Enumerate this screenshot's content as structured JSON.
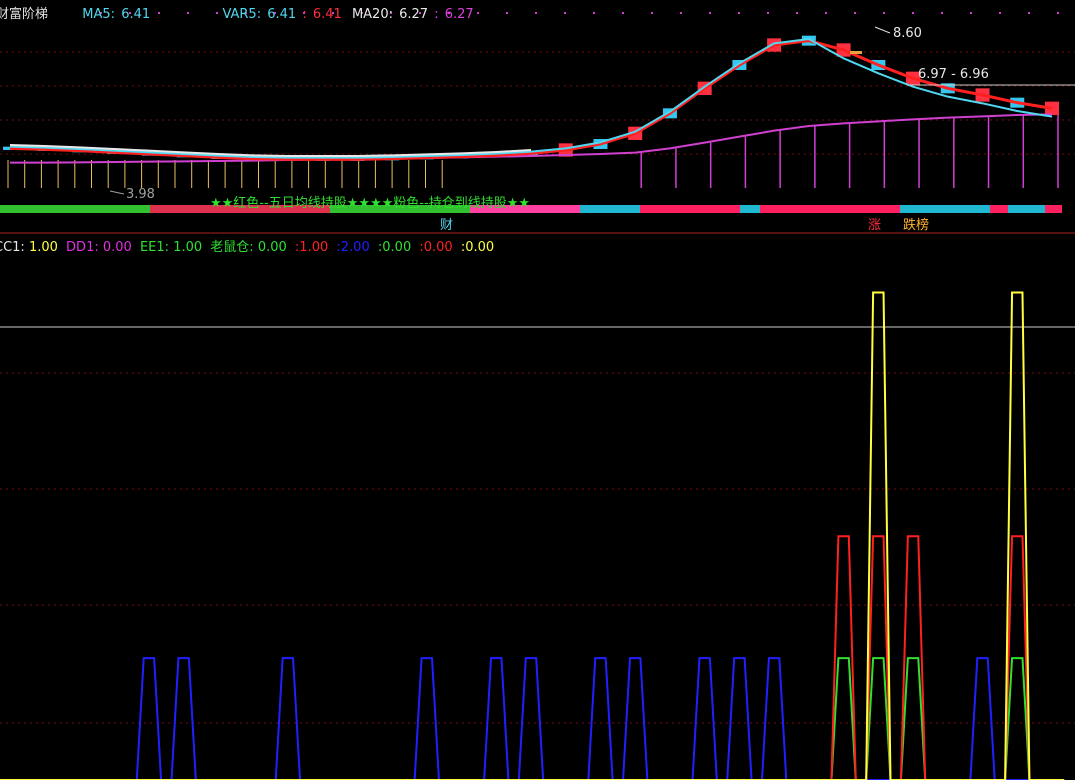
{
  "colors": {
    "background": "#000000",
    "up": "#ff3040",
    "down": "#34c8f0",
    "ma5": "#ff2020",
    "ma20": "#d040d0",
    "cyan_line": "#50d8f0",
    "white_line": "#e8e8e8",
    "gridline": "#7a0a0a",
    "yellow": "#ffff40",
    "green": "#30e030",
    "blue": "#2020ff",
    "red": "#ff2020",
    "magenta": "#e030e0"
  },
  "main_header": {
    "title": "财富阶梯",
    "ma5_label": "MA5:",
    "ma5_value": "6.41",
    "var5_label": "VAR5:",
    "var5_value1": "6.41",
    "var5_sep": ":",
    "var5_value2": "6.41",
    "ma20_label": "MA20:",
    "ma20_value1": "6.27",
    "ma20_sep": ":",
    "ma20_value2": "6.27"
  },
  "main_annotations": {
    "high_label": "8.60",
    "low_label": "3.98",
    "range_label": "6.97 - 6.96",
    "banner_text": "★★红色--五日均线持股★★★★粉色--持仓到线持股★★",
    "cai_label": "财",
    "zhang_label": "涨",
    "dieban_label": "跌榜"
  },
  "indicator_header": {
    "cc1_label": "CC1:",
    "cc1_value": "1.00",
    "dd1_label": "DD1:",
    "dd1_value": "0.00",
    "ee1_label": "EE1:",
    "ee1_value": "1.00",
    "lsc_label": "老鼠仓:",
    "lsc_value": "0.00",
    "v2": "1.00",
    "v3": "2.00",
    "v4": "0.00",
    "v5": "0.00",
    "v6": "0.00"
  },
  "chart_data": [
    {
      "type": "line",
      "title": "财富阶梯",
      "series": [
        {
          "name": "MA5",
          "values": [
            5.25,
            5.22,
            5.18,
            5.13,
            5.08,
            5.03,
            4.98,
            4.94,
            4.92,
            4.92,
            4.92,
            4.94,
            4.97,
            5.0,
            5.04,
            5.1,
            5.2,
            5.38,
            5.7,
            6.3,
            7.05,
            7.75,
            8.35,
            8.48,
            8.2,
            7.75,
            7.35,
            7.05,
            6.85,
            6.62,
            6.45
          ]
        },
        {
          "name": "MA20",
          "values": [
            4.82,
            4.82,
            4.83,
            4.84,
            4.85,
            4.86,
            4.87,
            4.88,
            4.9,
            4.92,
            4.93,
            4.95,
            4.96,
            4.98,
            5.0,
            5.02,
            5.05,
            5.08,
            5.12,
            5.25,
            5.42,
            5.6,
            5.78,
            5.92,
            6.0,
            6.06,
            6.12,
            6.17,
            6.21,
            6.25,
            6.27
          ]
        }
      ],
      "high": 8.6,
      "low": 3.98,
      "ylim": [
        3.7,
        9.1
      ]
    },
    {
      "type": "line",
      "title": "",
      "series": [
        {
          "name": "CC1",
          "values": [
            0,
            0,
            0,
            0,
            0,
            0,
            0,
            0,
            0,
            0,
            0,
            0,
            0,
            0,
            0,
            0,
            0,
            0,
            0,
            0,
            0,
            0,
            0,
            0,
            0,
            4.0,
            0,
            0,
            0,
            4.0,
            0
          ]
        },
        {
          "name": "DD1",
          "values": [
            0,
            0,
            0,
            0,
            0,
            0,
            0,
            0,
            0,
            0,
            0,
            0,
            0,
            0,
            0,
            0,
            0,
            0,
            0,
            0,
            0,
            0,
            0,
            0,
            0,
            0,
            0,
            0,
            0,
            0,
            0
          ]
        },
        {
          "name": "EE1",
          "values": [
            0,
            0,
            0,
            0,
            0,
            0,
            0,
            0,
            0,
            0,
            0,
            0,
            0,
            0,
            0,
            0,
            0,
            0,
            0,
            0,
            0,
            0,
            0,
            0,
            1.0,
            1.0,
            1.0,
            0,
            0,
            1.0,
            0
          ]
        },
        {
          "name": "老鼠仓",
          "values": [
            0,
            0,
            0,
            0,
            1,
            1,
            0,
            0,
            1,
            0,
            0,
            0,
            1,
            0,
            1,
            1,
            0,
            1,
            1,
            0,
            1,
            1,
            1,
            0,
            0,
            0,
            0,
            0,
            1,
            0,
            0
          ]
        }
      ],
      "red_values": [
        0,
        0,
        0,
        0,
        0,
        0,
        0,
        0,
        0,
        0,
        0,
        0,
        0,
        0,
        0,
        0,
        0,
        0,
        0,
        0,
        0,
        0,
        0,
        0,
        2.0,
        2.0,
        2.0,
        0,
        0,
        2.0,
        0
      ],
      "ylim": [
        0,
        4.3
      ]
    }
  ]
}
